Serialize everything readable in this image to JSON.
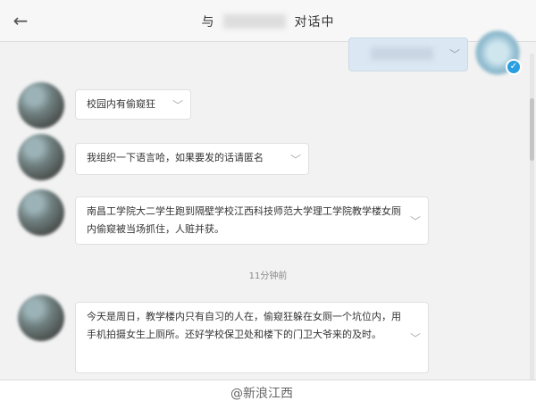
{
  "header": {
    "title_prefix": "与",
    "title_suffix": "对话中",
    "back_icon": "←"
  },
  "messages": [
    {
      "text": "校园内有偷窥狂"
    },
    {
      "text": "我组织一下语言哈，如果要发的话请匿名"
    },
    {
      "text": "南昌工学院大二学生跑到隔壁学校江西科技师范大学理工学院教学楼女厕内偷窥被当场抓住，人赃并获。"
    },
    {
      "text": "今天是周日，教学楼内只有自习的人在，偷窥狂躲在女厕一个坑位内，用手机拍摄女生上厕所。还好学校保卫处和楼下的门卫大爷来的及时。"
    }
  ],
  "timestamp": "11分钟前",
  "watermark": "@新浪江西",
  "chevron": "﹀",
  "colors": {
    "verified": "#2a9ee0",
    "mine_bubble": "#dbe8f4"
  }
}
